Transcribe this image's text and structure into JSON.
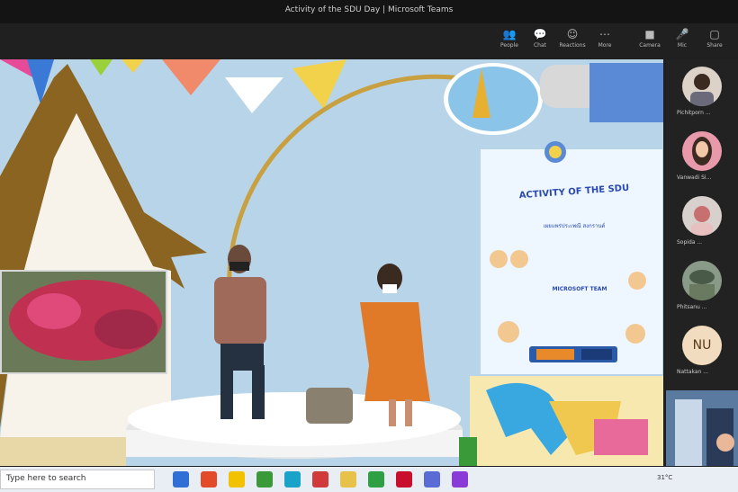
{
  "window": {
    "title": "Activity of the SDU Day | Microsoft Teams"
  },
  "toolbar": {
    "buttons": [
      {
        "key": "people",
        "icon": "👥",
        "label": "People"
      },
      {
        "key": "chat",
        "icon": "💬",
        "label": "Chat"
      },
      {
        "key": "reactions",
        "icon": "☺",
        "label": "Reactions"
      },
      {
        "key": "more",
        "icon": "⋯",
        "label": "More"
      },
      {
        "key": "camera",
        "icon": "■",
        "label": "Camera"
      },
      {
        "key": "mic",
        "icon": "🎤",
        "label": "Mic"
      },
      {
        "key": "share",
        "icon": "▢",
        "label": "Share"
      }
    ]
  },
  "stage": {
    "poster": {
      "title": "ACTIVITY OF THE SDU",
      "subtitle": "เผยแพร่ประเพณี สงกรานต์",
      "team": "MICROSOFT TEAM"
    }
  },
  "participants": [
    {
      "name": "Pichitporn ...",
      "initials": ""
    },
    {
      "name": "Vanwadi Si...",
      "initials": ""
    },
    {
      "name": "Sopida ...",
      "initials": ""
    },
    {
      "name": "Phitsanu ...",
      "initials": ""
    },
    {
      "name": "Nattakan ...",
      "initials": "NU"
    }
  ],
  "taskbar": {
    "search_placeholder": "Type here to search",
    "weather": "31°C",
    "time": "",
    "colors": [
      "#2f6fd6",
      "#e24a2a",
      "#f2c200",
      "#3a9a3a",
      "#1aa3c9",
      "#d03a3a",
      "#e6c24a",
      "#2ea043",
      "#c8102e",
      "#5b6bd6",
      "#8a3ad6"
    ]
  },
  "colors": {
    "accent": "#6264a7"
  }
}
